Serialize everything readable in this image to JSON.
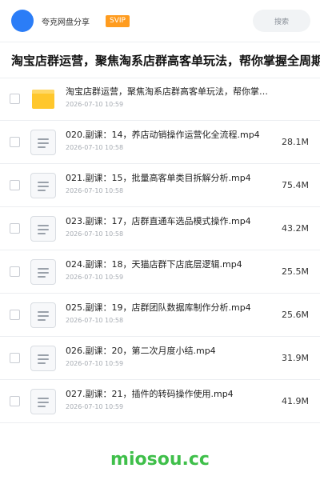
{
  "header": {
    "brand": "夸克网盘分享",
    "badge": "SVIP",
    "search_placeholder": "搜索"
  },
  "title": "淘宝店群运营，聚焦淘系店群高客单玩法，帮你掌握全周期",
  "files": [
    {
      "icon": "folder-icon",
      "name": "淘宝店群运营，聚焦淘系店群高客单玩法，帮你掌握全周期…",
      "date": "2026-07-10 10:59",
      "size": ""
    },
    {
      "icon": "file-icon",
      "name": "020.副课：14，养店动销操作运营化全流程.mp4",
      "date": "2026-07-10 10:58",
      "size": "28.1M"
    },
    {
      "icon": "file-icon",
      "name": "021.副课：15，批量高客单类目拆解分析.mp4",
      "date": "2026-07-10 10:58",
      "size": "75.4M"
    },
    {
      "icon": "file-icon",
      "name": "023.副课：17，店群直通车选品模式操作.mp4",
      "date": "2026-07-10 10:58",
      "size": "43.2M"
    },
    {
      "icon": "file-icon",
      "name": "024.副课：18，天猫店群下店底层逻辑.mp4",
      "date": "2026-07-10 10:59",
      "size": "25.5M"
    },
    {
      "icon": "file-icon",
      "name": "025.副课：19，店群团队数据库制作分析.mp4",
      "date": "2026-07-10 10:58",
      "size": "25.6M"
    },
    {
      "icon": "file-icon",
      "name": "026.副课：20，第二次月度小结.mp4",
      "date": "2026-07-10 10:59",
      "size": "31.9M"
    },
    {
      "icon": "file-icon",
      "name": "027.副课：21，插件的转码操作使用.mp4",
      "date": "2026-07-10 10:59",
      "size": "41.9M"
    }
  ],
  "watermark": "miosou.cc",
  "colors": {
    "accent": "#2b7df7",
    "svip": "#ff9c1f",
    "watermark": "#3fbf4a"
  }
}
